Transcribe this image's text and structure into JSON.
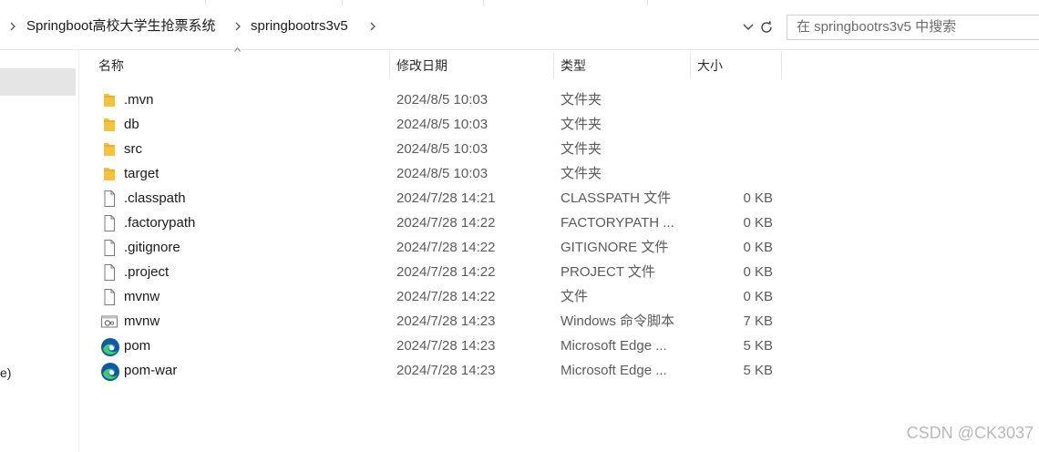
{
  "breadcrumb": {
    "items": [
      "Springboot高校大学生抢票系统",
      "springbootrs3v5"
    ]
  },
  "search": {
    "placeholder": "在 springbootrs3v5 中搜索"
  },
  "columns": {
    "name": "名称",
    "date": "修改日期",
    "type": "类型",
    "size": "大小"
  },
  "nav": {
    "fragment": "e)"
  },
  "files": [
    {
      "name": ".mvn",
      "date": "2024/8/5 10:03",
      "type": "文件夹",
      "size": "",
      "icon": "folder-icon"
    },
    {
      "name": "db",
      "date": "2024/8/5 10:03",
      "type": "文件夹",
      "size": "",
      "icon": "folder-icon"
    },
    {
      "name": "src",
      "date": "2024/8/5 10:03",
      "type": "文件夹",
      "size": "",
      "icon": "folder-icon"
    },
    {
      "name": "target",
      "date": "2024/8/5 10:03",
      "type": "文件夹",
      "size": "",
      "icon": "folder-icon"
    },
    {
      "name": ".classpath",
      "date": "2024/7/28 14:21",
      "type": "CLASSPATH 文件",
      "size": "0 KB",
      "icon": "file-icon"
    },
    {
      "name": ".factorypath",
      "date": "2024/7/28 14:22",
      "type": "FACTORYPATH ...",
      "size": "0 KB",
      "icon": "file-icon"
    },
    {
      "name": ".gitignore",
      "date": "2024/7/28 14:22",
      "type": "GITIGNORE 文件",
      "size": "0 KB",
      "icon": "file-icon"
    },
    {
      "name": ".project",
      "date": "2024/7/28 14:22",
      "type": "PROJECT 文件",
      "size": "0 KB",
      "icon": "file-icon"
    },
    {
      "name": "mvnw",
      "date": "2024/7/28 14:22",
      "type": "文件",
      "size": "0 KB",
      "icon": "file-icon"
    },
    {
      "name": "mvnw",
      "date": "2024/7/28 14:23",
      "type": "Windows 命令脚本",
      "size": "7 KB",
      "icon": "script-icon"
    },
    {
      "name": "pom",
      "date": "2024/7/28 14:23",
      "type": "Microsoft Edge ...",
      "size": "5 KB",
      "icon": "edge-icon"
    },
    {
      "name": "pom-war",
      "date": "2024/7/28 14:23",
      "type": "Microsoft Edge ...",
      "size": "5 KB",
      "icon": "edge-icon"
    }
  ],
  "watermark": "CSDN @CK3037",
  "colors": {
    "folder": "#f5c33b",
    "edge_blue": "#0c59a4",
    "edge_green": "#3bcf6b",
    "selection": "#e5e5e5"
  }
}
